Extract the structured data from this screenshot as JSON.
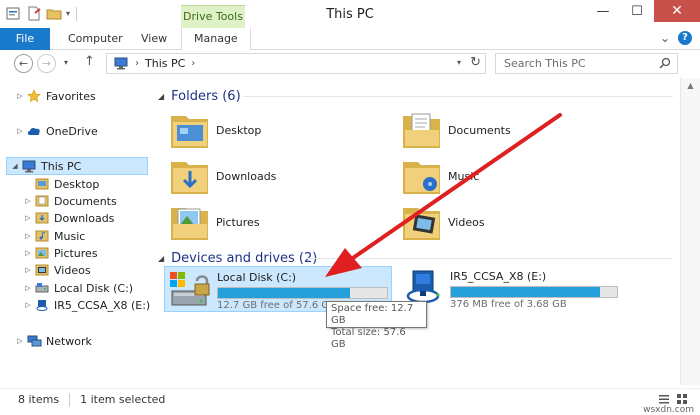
{
  "window": {
    "title": "This PC",
    "context_tab": "Drive Tools",
    "minimize": "—",
    "maximize": "☐",
    "close": "✕"
  },
  "ribbon": {
    "file": "File",
    "computer": "Computer",
    "view": "View",
    "manage": "Manage",
    "expand": "⌄",
    "help": "?"
  },
  "address": {
    "crumb": "This PC",
    "chevron": "›",
    "search_placeholder": "Search This PC"
  },
  "nav": {
    "favorites": "Favorites",
    "onedrive": "OneDrive",
    "thispc": "This PC",
    "items": [
      "Desktop",
      "Documents",
      "Downloads",
      "Music",
      "Pictures",
      "Videos",
      "Local Disk (C:)",
      "IR5_CCSA_X8 (E:)"
    ],
    "network": "Network"
  },
  "folders": {
    "header": "Folders (6)",
    "items": [
      "Desktop",
      "Documents",
      "Downloads",
      "Music",
      "Pictures",
      "Videos"
    ]
  },
  "drives": {
    "header": "Devices and drives (2)",
    "items": [
      {
        "name": "Local Disk (C:)",
        "free": "12.7 GB free of 57.6 GB",
        "used_fraction": 0.78
      },
      {
        "name": "IR5_CCSA_X8 (E:)",
        "free": "376 MB free of 3.68 GB",
        "used_fraction": 0.9
      }
    ]
  },
  "tooltip": {
    "line1": "Space free: 12.7 GB",
    "line2": "Total size: 57.6 GB"
  },
  "status": {
    "count": "8 items",
    "selected": "1 item selected"
  },
  "watermark": "wsxdn.com",
  "colors": {
    "accent": "#1979ca",
    "selection": "#cce8ff",
    "bar_fill": "#26a0da",
    "annotation_arrow": "#e02020"
  }
}
